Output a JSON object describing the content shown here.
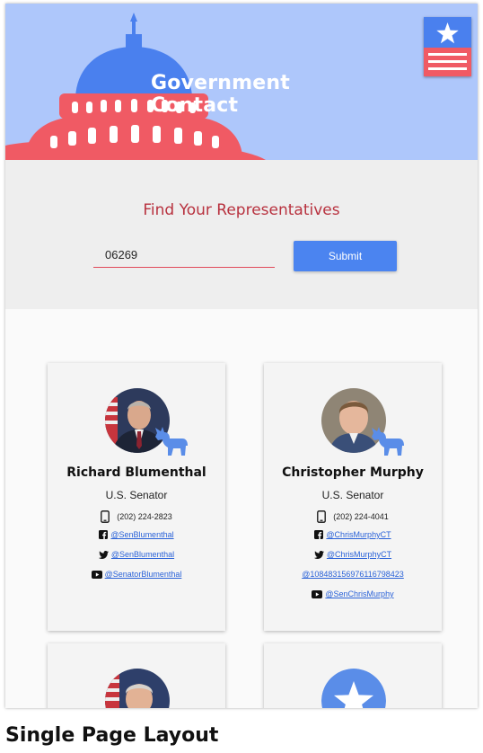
{
  "header": {
    "title": "Government Contact"
  },
  "colors": {
    "header_bg": "#aec7fb",
    "capitol_red": "#f05a64",
    "dome_blue": "#4a80ee",
    "heading_red": "#b8323f",
    "button_blue": "#4b84f0",
    "link_blue": "#2a62d8"
  },
  "search": {
    "heading": "Find Your Representatives",
    "zip_value": "06269",
    "submit_label": "Submit"
  },
  "representatives": [
    {
      "name": "Richard Blumenthal",
      "office": "U.S. Senator",
      "party_icon": "donkey-icon",
      "phone": "(202) 224-2823",
      "facebook": "@SenBlumenthal",
      "twitter": "@SenBlumenthal",
      "youtube": "@SenatorBlumenthal"
    },
    {
      "name": "Christopher Murphy",
      "office": "U.S. Senator",
      "party_icon": "donkey-icon",
      "phone": "(202) 224-4041",
      "facebook": "@ChrisMurphyCT",
      "twitter": "@ChrisMurphyCT",
      "other_id": "@108483156976116798423",
      "youtube": "@SenChrisMurphy"
    }
  ],
  "caption": "Single Page Layout"
}
